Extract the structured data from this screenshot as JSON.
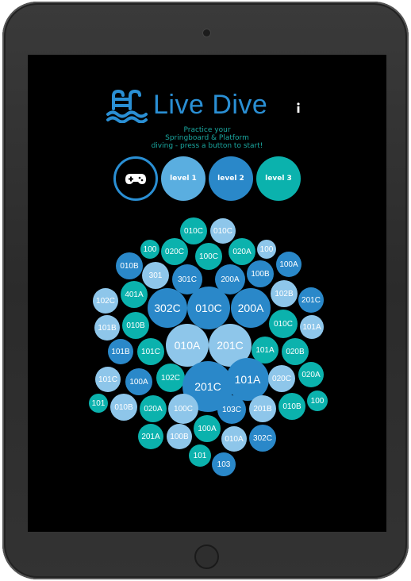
{
  "app": {
    "title": "Live Dive",
    "tagline": [
      "Practice your",
      "Springboard & Platform",
      "diving - press a button to start!"
    ]
  },
  "colors": {
    "light": "#8ec6ea",
    "mid": "#2a88c9",
    "teal": "#0bb2ad",
    "accent": "#2a8fd4"
  },
  "buttons": {
    "game_icon": "gamepad-icon",
    "level1": "level 1",
    "level2": "level 2",
    "level3": "level 3"
  },
  "dives": [
    {
      "label": "010C",
      "color": "teal"
    },
    {
      "label": "010C",
      "color": "light"
    },
    {
      "label": "100",
      "color": "teal"
    },
    {
      "label": "020C",
      "color": "teal"
    },
    {
      "label": "100C",
      "color": "teal"
    },
    {
      "label": "020A",
      "color": "teal"
    },
    {
      "label": "100",
      "color": "light"
    },
    {
      "label": "010B",
      "color": "mid"
    },
    {
      "label": "301",
      "color": "light"
    },
    {
      "label": "301C",
      "color": "mid"
    },
    {
      "label": "200A",
      "color": "mid"
    },
    {
      "label": "100B",
      "color": "mid"
    },
    {
      "label": "100A",
      "color": "mid"
    },
    {
      "label": "102C",
      "color": "light"
    },
    {
      "label": "401A",
      "color": "teal"
    },
    {
      "label": "302C",
      "color": "mid"
    },
    {
      "label": "010C",
      "color": "mid"
    },
    {
      "label": "200A",
      "color": "mid"
    },
    {
      "label": "102B",
      "color": "light"
    },
    {
      "label": "201C",
      "color": "mid"
    },
    {
      "label": "101B",
      "color": "light"
    },
    {
      "label": "010B",
      "color": "teal"
    },
    {
      "label": "010C",
      "color": "teal"
    },
    {
      "label": "101A",
      "color": "light"
    },
    {
      "label": "010A",
      "color": "light"
    },
    {
      "label": "201C",
      "color": "light"
    },
    {
      "label": "101B",
      "color": "mid"
    },
    {
      "label": "101C",
      "color": "teal"
    },
    {
      "label": "101A",
      "color": "teal"
    },
    {
      "label": "020B",
      "color": "teal"
    },
    {
      "label": "101C",
      "color": "light"
    },
    {
      "label": "100A",
      "color": "mid"
    },
    {
      "label": "102C",
      "color": "teal"
    },
    {
      "label": "201C",
      "color": "mid"
    },
    {
      "label": "101A",
      "color": "mid"
    },
    {
      "label": "020C",
      "color": "light"
    },
    {
      "label": "020A",
      "color": "teal"
    },
    {
      "label": "101",
      "color": "teal"
    },
    {
      "label": "010B",
      "color": "light"
    },
    {
      "label": "020A",
      "color": "teal"
    },
    {
      "label": "100C",
      "color": "light"
    },
    {
      "label": "103C",
      "color": "mid"
    },
    {
      "label": "201B",
      "color": "light"
    },
    {
      "label": "010B",
      "color": "teal"
    },
    {
      "label": "100",
      "color": "teal"
    },
    {
      "label": "100A",
      "color": "teal"
    },
    {
      "label": "201A",
      "color": "teal"
    },
    {
      "label": "100B",
      "color": "light"
    },
    {
      "label": "010A",
      "color": "light"
    },
    {
      "label": "302C",
      "color": "mid"
    },
    {
      "label": "101",
      "color": "teal"
    },
    {
      "label": "103",
      "color": "mid"
    }
  ]
}
